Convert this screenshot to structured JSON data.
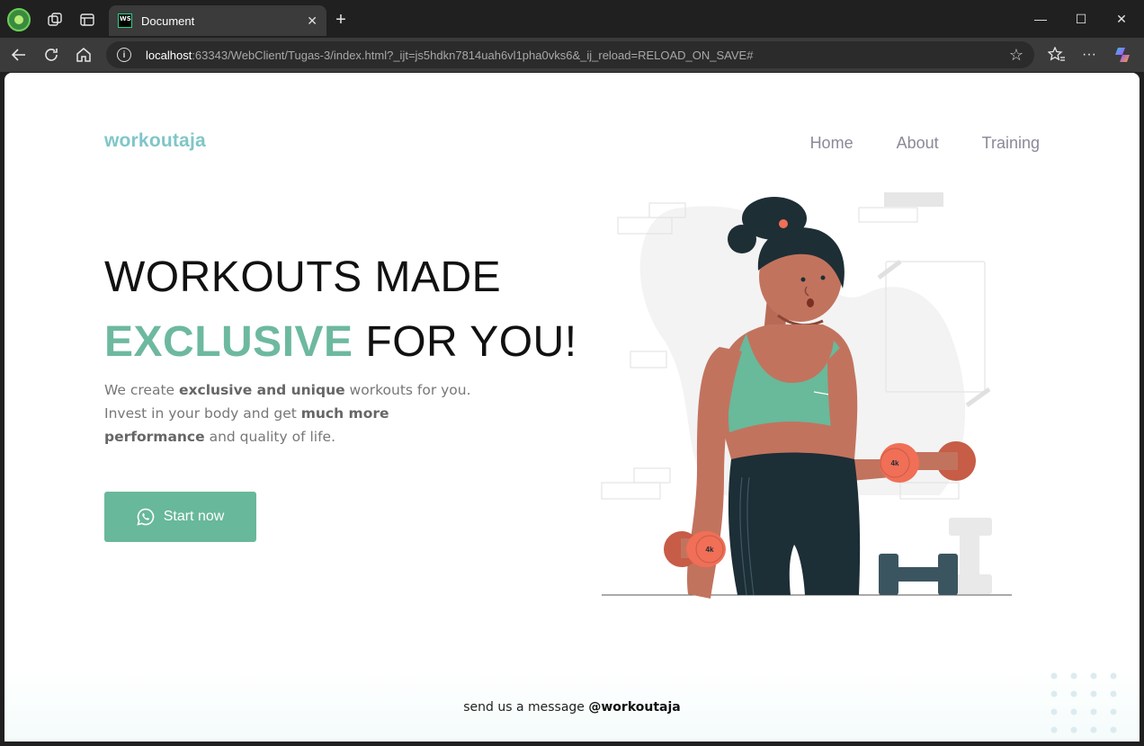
{
  "browser": {
    "tab_title": "Document",
    "url_host": "localhost",
    "url_rest": ":63343/WebClient/Tugas-3/index.html?_ijt=js5hdkn7814uah6vl1pha0vks6&_ij_reload=RELOAD_ON_SAVE#",
    "tab_favicon_text": "WS"
  },
  "page": {
    "logo": "workoutaja",
    "nav": [
      "Home",
      "About",
      "Training"
    ],
    "hero": {
      "line1": "WORKOUTS MADE",
      "accent": "EXCLUSIVE",
      "line2_rest": " FOR YOU!"
    },
    "description": {
      "p1": "We create ",
      "b1": "exclusive and unique",
      "p2": " workouts for you. Invest in your body and get ",
      "b2": "much more performance",
      "p3": " and quality of life."
    },
    "cta_label": "Start now",
    "dumbbell_label": "4k",
    "footer": {
      "text": "send us a message ",
      "handle": "@workoutaja"
    }
  },
  "colors": {
    "accent": "#6db99f",
    "logo": "#7fc6c8",
    "button": "#68b89b",
    "dumbbell": "#f06f56",
    "top": "#69b99b",
    "pants": "#1c2e36",
    "skin": "#c2735e"
  },
  "icons": [
    "back-icon",
    "refresh-icon",
    "home-icon",
    "info-icon",
    "star-icon",
    "favorites-icon",
    "more-icon",
    "copilot-icon",
    "whatsapp-icon"
  ]
}
